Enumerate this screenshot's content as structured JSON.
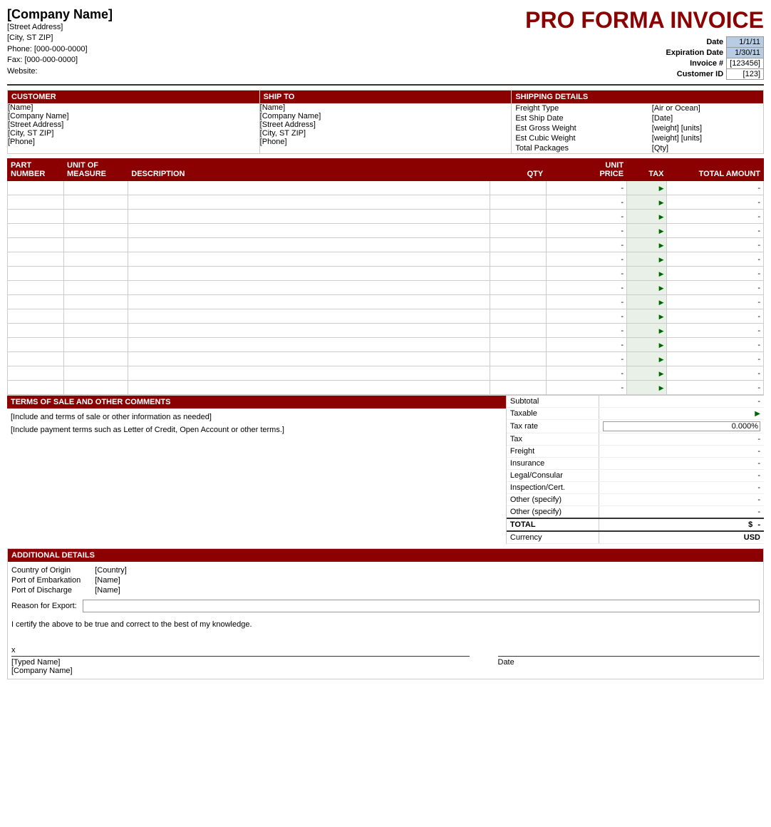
{
  "header": {
    "company_name": "[Company Name]",
    "street": "[Street Address]",
    "city": "[City, ST  ZIP]",
    "phone": "Phone: [000-000-0000]",
    "fax": "Fax: [000-000-0000]",
    "website": "Website:",
    "invoice_title": "PRO FORMA INVOICE",
    "date_label": "Date",
    "date_value": "1/1/11",
    "expiration_label": "Expiration Date",
    "expiration_value": "1/30/11",
    "invoice_label": "Invoice #",
    "invoice_value": "[123456]",
    "customer_label": "Customer ID",
    "customer_value": "[123]"
  },
  "customer": {
    "header": "CUSTOMER",
    "name": "[Name]",
    "company": "[Company Name]",
    "street": "[Street Address]",
    "city": "[City, ST  ZIP]",
    "phone": "[Phone]"
  },
  "ship_to": {
    "header": "SHIP TO",
    "name": "[Name]",
    "company": "[Company Name]",
    "street": "[Street Address]",
    "city": "[City, ST  ZIP]",
    "phone": "[Phone]"
  },
  "shipping_details": {
    "header": "SHIPPING DETAILS",
    "rows": [
      {
        "label": "Freight Type",
        "value": "[Air or Ocean]"
      },
      {
        "label": "Est Ship Date",
        "value": "[Date]"
      },
      {
        "label": "Est Gross Weight",
        "value": "[weight] [units]"
      },
      {
        "label": "Est Cubic Weight",
        "value": "[weight] [units]"
      },
      {
        "label": "Total Packages",
        "value": "[Qty]"
      }
    ]
  },
  "table": {
    "headers": [
      {
        "id": "part-number",
        "line1": "PART",
        "line2": "NUMBER"
      },
      {
        "id": "unit-of-measure",
        "line1": "UNIT OF",
        "line2": "MEASURE"
      },
      {
        "id": "description",
        "line1": "DESCRIPTION",
        "line2": ""
      },
      {
        "id": "qty",
        "line1": "QTY",
        "line2": ""
      },
      {
        "id": "unit-price",
        "line1": "UNIT",
        "line2": "PRICE"
      },
      {
        "id": "tax",
        "line1": "TAX",
        "line2": ""
      },
      {
        "id": "total-amount",
        "line1": "TOTAL AMOUNT",
        "line2": ""
      }
    ],
    "rows": [
      {
        "part": "",
        "unit": "",
        "desc": "",
        "qty": "",
        "price": "-",
        "tax": "",
        "total": "-"
      },
      {
        "part": "",
        "unit": "",
        "desc": "",
        "qty": "",
        "price": "-",
        "tax": "",
        "total": "-"
      },
      {
        "part": "",
        "unit": "",
        "desc": "",
        "qty": "",
        "price": "-",
        "tax": "",
        "total": "-"
      },
      {
        "part": "",
        "unit": "",
        "desc": "",
        "qty": "",
        "price": "-",
        "tax": "",
        "total": "-"
      },
      {
        "part": "",
        "unit": "",
        "desc": "",
        "qty": "",
        "price": "-",
        "tax": "",
        "total": "-"
      },
      {
        "part": "",
        "unit": "",
        "desc": "",
        "qty": "",
        "price": "-",
        "tax": "",
        "total": "-"
      },
      {
        "part": "",
        "unit": "",
        "desc": "",
        "qty": "",
        "price": "-",
        "tax": "",
        "total": "-"
      },
      {
        "part": "",
        "unit": "",
        "desc": "",
        "qty": "",
        "price": "-",
        "tax": "",
        "total": "-"
      },
      {
        "part": "",
        "unit": "",
        "desc": "",
        "qty": "",
        "price": "-",
        "tax": "",
        "total": "-"
      },
      {
        "part": "",
        "unit": "",
        "desc": "",
        "qty": "",
        "price": "-",
        "tax": "",
        "total": "-"
      },
      {
        "part": "",
        "unit": "",
        "desc": "",
        "qty": "",
        "price": "-",
        "tax": "",
        "total": "-"
      },
      {
        "part": "",
        "unit": "",
        "desc": "",
        "qty": "",
        "price": "-",
        "tax": "",
        "total": "-"
      },
      {
        "part": "",
        "unit": "",
        "desc": "",
        "qty": "",
        "price": "-",
        "tax": "",
        "total": "-"
      },
      {
        "part": "",
        "unit": "",
        "desc": "",
        "qty": "",
        "price": "-",
        "tax": "",
        "total": "-"
      },
      {
        "part": "",
        "unit": "",
        "desc": "",
        "qty": "",
        "price": "-",
        "tax": "",
        "total": "-"
      }
    ]
  },
  "terms": {
    "header": "TERMS OF SALE AND OTHER COMMENTS",
    "line1": "[Include and terms of sale or other information as needed]",
    "line2": "[Include payment terms such as Letter of Credit, Open Account or other terms.]"
  },
  "totals": {
    "subtotal_label": "Subtotal",
    "subtotal_value": "-",
    "taxable_label": "Taxable",
    "taxable_value": "",
    "tax_rate_label": "Tax rate",
    "tax_rate_value": "0.000%",
    "tax_label": "Tax",
    "tax_value": "-",
    "freight_label": "Freight",
    "freight_value": "-",
    "insurance_label": "Insurance",
    "insurance_value": "-",
    "legal_label": "Legal/Consular",
    "legal_value": "-",
    "inspection_label": "Inspection/Cert.",
    "inspection_value": "-",
    "other1_label": "Other (specify)",
    "other1_value": "-",
    "other2_label": "Other (specify)",
    "other2_value": "-",
    "total_label": "TOTAL",
    "total_dollar": "$",
    "total_value": "-",
    "currency_label": "Currency",
    "currency_value": "USD"
  },
  "additional": {
    "header": "ADDITIONAL DETAILS",
    "country_label": "Country of Origin",
    "country_value": "[Country]",
    "port_embark_label": "Port of Embarkation",
    "port_embark_value": "[Name]",
    "port_discharge_label": "Port of Discharge",
    "port_discharge_value": "[Name]",
    "reason_label": "Reason for Export:",
    "certify_text": "I certify the above to be true and correct to the best of my knowledge.",
    "sig_x": "x",
    "typed_name": "[Typed Name]",
    "company_name": "[Company Name]",
    "date_label": "Date"
  }
}
